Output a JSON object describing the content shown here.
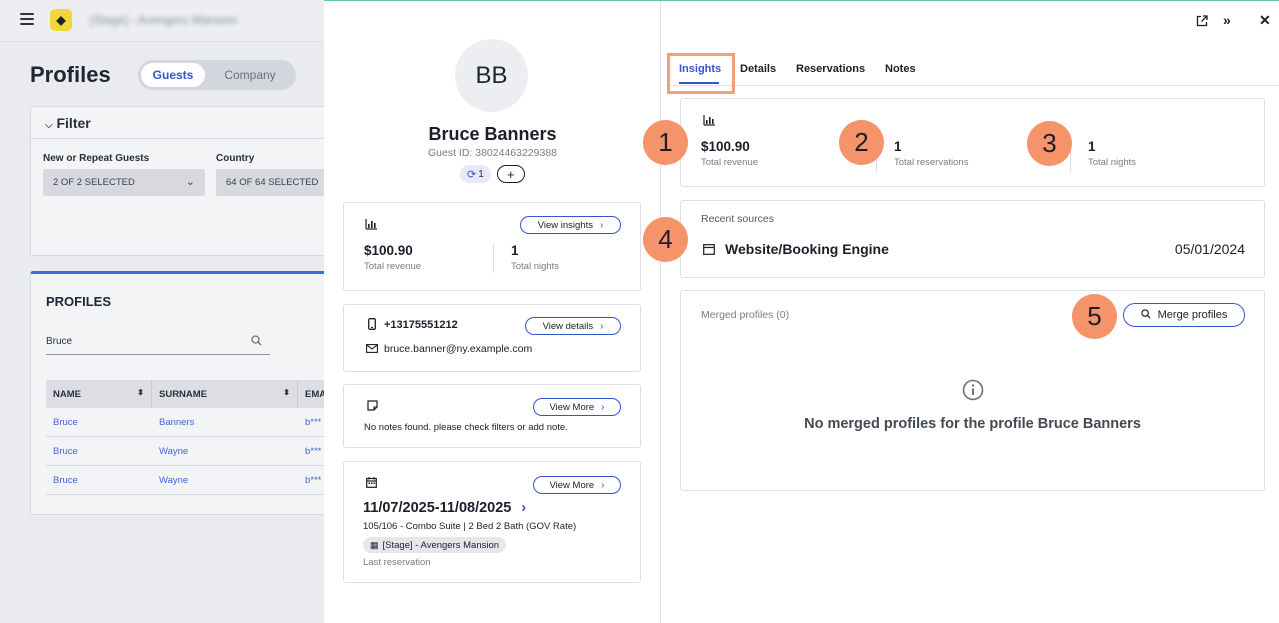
{
  "app": {
    "breadcrumb": "[Stage] - Avengers Mansion",
    "page_title": "Profiles",
    "segment": {
      "guests": "Guests",
      "company": "Company"
    },
    "filter": {
      "title": "Filter",
      "new_repeat_label": "New or Repeat Guests",
      "new_repeat_value": "2 OF 2 SELECTED",
      "country_label": "Country",
      "country_value": "64 OF 64 SELECTED"
    },
    "profiles": {
      "title": "PROFILES",
      "search_value": "Bruce",
      "columns": [
        "NAME",
        "SURNAME",
        "EMA"
      ],
      "rows": [
        [
          "Bruce",
          "Banners",
          "b***"
        ],
        [
          "Bruce",
          "Wayne",
          "b***"
        ],
        [
          "Bruce",
          "Wayne",
          "b***"
        ]
      ]
    }
  },
  "guest": {
    "initials": "BB",
    "name": "Bruce Banners",
    "guest_id": "Guest ID: 38024463229388",
    "merge_count": "1",
    "add_symbol": "+"
  },
  "insights_card": {
    "button": "View insights",
    "revenue_value": "$100.90",
    "revenue_label": "Total revenue",
    "nights_value": "1",
    "nights_label": "Total nights"
  },
  "contact_card": {
    "button": "View details",
    "phone": "+13175551212",
    "email": "bruce.banner@ny.example.com"
  },
  "notes_card": {
    "button": "View More",
    "text": "No notes found. please check filters or add note."
  },
  "reservation_card": {
    "button": "View More",
    "dates": "11/07/2025-11/08/2025",
    "room": "105/106 - Combo Suite | 2 Bed 2 Bath (GOV Rate)",
    "property": "[Stage] - Avengers Mansion",
    "caption": "Last reservation"
  },
  "tabs": [
    "Insights",
    "Details",
    "Reservations",
    "Notes"
  ],
  "stats": {
    "revenue_value": "$100.90",
    "revenue_label": "Total revenue",
    "reservations_value": "1",
    "reservations_label": "Total reservations",
    "nights_value": "1",
    "nights_label": "Total nights"
  },
  "sources": {
    "title": "Recent sources",
    "name": "Website/Booking Engine",
    "date": "05/01/2024"
  },
  "merged": {
    "title": "Merged profiles (0)",
    "button": "Merge profiles",
    "empty_text": "No merged profiles for the profile Bruce Banners"
  },
  "badges": [
    "1",
    "2",
    "3",
    "4",
    "5"
  ],
  "colors": {
    "accent": "#3554d1",
    "badge": "#f5936a",
    "highlight": "#f2a07a",
    "drawer_top": "#5ac8b2"
  }
}
